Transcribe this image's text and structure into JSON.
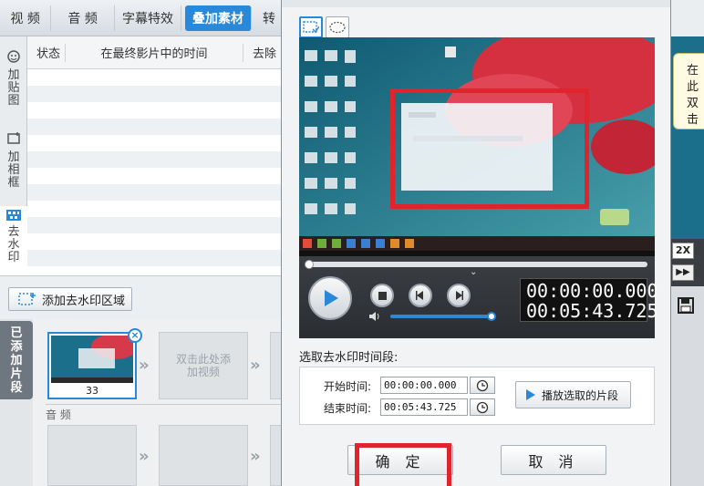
{
  "tabs": [
    "视 频",
    "音 频",
    "字幕特效",
    "叠加素材",
    "转"
  ],
  "sidebar": {
    "items": [
      {
        "icon": "sticker-icon",
        "label": "加贴图"
      },
      {
        "icon": "frame-icon",
        "label": "加相框"
      },
      {
        "icon": "mosaic-icon",
        "label": "去水印"
      }
    ]
  },
  "table": {
    "headers": [
      "状态",
      "在最终影片中的时间",
      "去除"
    ]
  },
  "add_region_button": "添加去水印区域",
  "clips": {
    "label": "已添加片段",
    "clip_number": "33",
    "placeholder": "双击此处添加视频",
    "audio_label": "音 频"
  },
  "dialog": {
    "player": {
      "current_time": "00:00:00.000",
      "total_time": "00:05:43.725"
    },
    "time_section_title": "选取去水印时间段:",
    "start_label": "开始时间:",
    "start_value": "00:00:00.000",
    "end_label": "结束时间:",
    "end_value": "00:05:43.725",
    "play_selected": "播放选取的片段",
    "ok": "确 定",
    "cancel": "取 消"
  },
  "right_edge": {
    "tooltip_line1": "在此",
    "tooltip_line2": "双击",
    "speed": "2X"
  },
  "colors": {
    "accent": "#2a88d8",
    "highlight": "#e0242c"
  }
}
